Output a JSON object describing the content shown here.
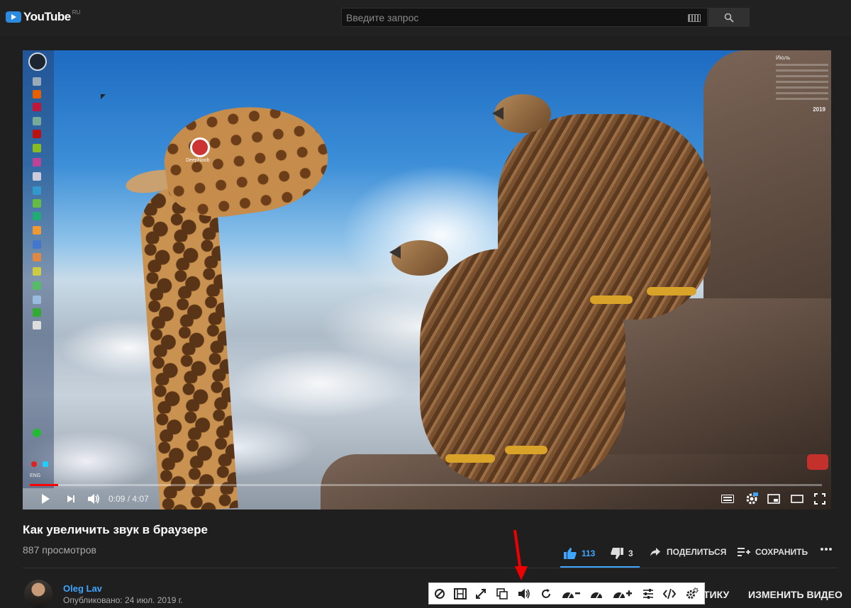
{
  "header": {
    "logo_text": "YouTube",
    "logo_region": "RU",
    "search_placeholder": "Введите запрос",
    "icons": [
      "keyboard-icon",
      "search-icon"
    ]
  },
  "player": {
    "desktop": {
      "icon_label": "DeepNoob",
      "calendar_month": "Июль",
      "calendar_year": "2019",
      "language": "ENG"
    },
    "current_time": "0:09",
    "duration": "4:07",
    "time_display": "0:09 / 4:07",
    "progress": 0.036,
    "colors": {
      "progress": "#ff0000",
      "accent": "#3ea6ff"
    }
  },
  "video": {
    "title": "Как увеличить звук в браузере",
    "views": "887 просмотров",
    "likes": "113",
    "dislikes": "3",
    "share_label": "ПОДЕЛИТЬСЯ",
    "save_label": "СОХРАНИТЬ"
  },
  "channel": {
    "name": "Oleg Lav",
    "published": "Опубликовано: 24 июл. 2019 г.",
    "analytics_label": "ТИКУ",
    "edit_label": "ИЗМЕНИТЬ ВИДЕО"
  },
  "extension_toolbar": {
    "buttons": [
      "block-icon",
      "film-icon",
      "expand-icon",
      "copy-icon",
      "volume-icon",
      "reload-icon",
      "speed-down-icon",
      "speed-icon",
      "speed-up-icon",
      "equalizer-icon",
      "code-icon",
      "settings-icon"
    ]
  }
}
